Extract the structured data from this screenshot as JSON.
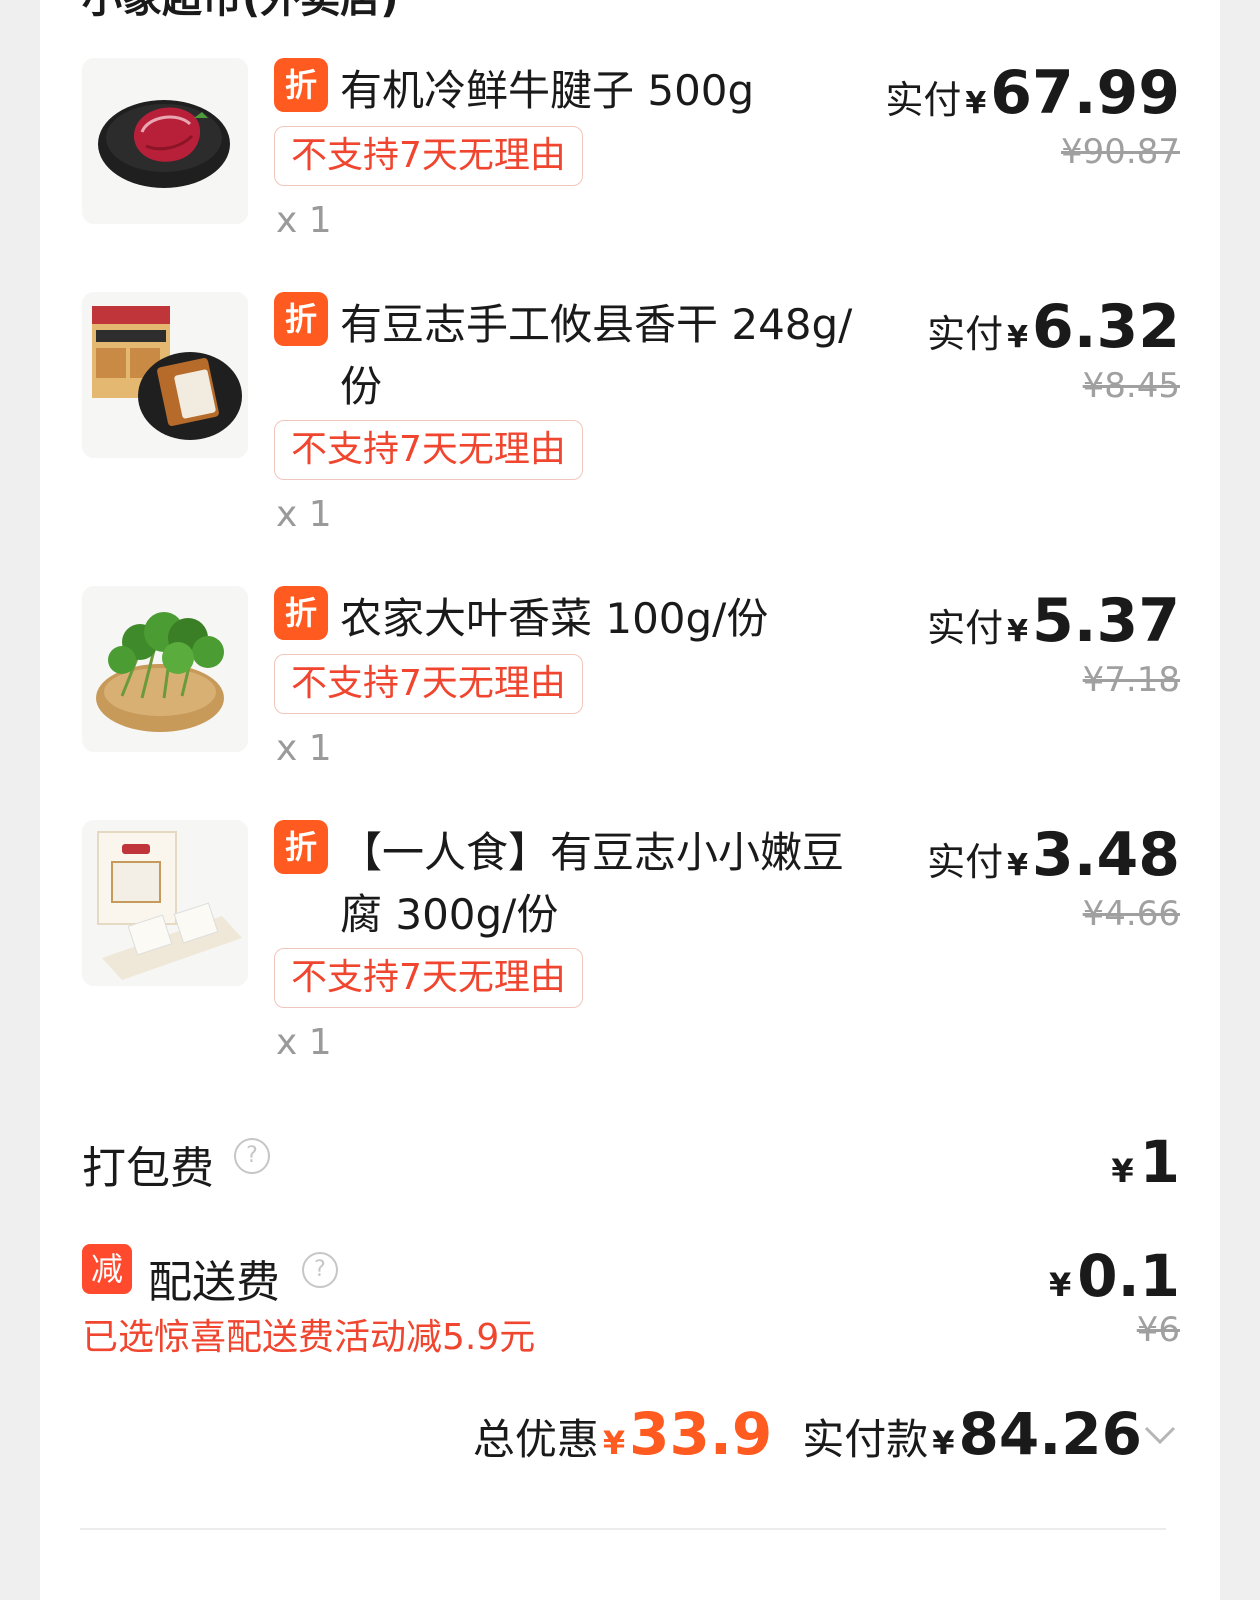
{
  "section": {
    "title": "小象超市(外卖店)"
  },
  "items": [
    {
      "name": "有机冷鲜牛腱子 500g",
      "badge": "折",
      "tag": "不支持7天无理由",
      "qty": "x 1",
      "paid_label": "实付",
      "currency": "¥",
      "price": "67.99",
      "orig_price": "¥90.87",
      "image_icon": "beef-shank-image"
    },
    {
      "name": "有豆志手工攸县香干 248g/份",
      "badge": "折",
      "tag": "不支持7天无理由",
      "qty": "x 1",
      "paid_label": "实付",
      "currency": "¥",
      "price": "6.32",
      "orig_price": "¥8.45",
      "image_icon": "dried-tofu-image"
    },
    {
      "name": "农家大叶香菜 100g/份",
      "badge": "折",
      "tag": "不支持7天无理由",
      "qty": "x 1",
      "paid_label": "实付",
      "currency": "¥",
      "price": "5.37",
      "orig_price": "¥7.18",
      "image_icon": "coriander-image"
    },
    {
      "name": "【一人食】有豆志小小嫩豆腐 300g/份",
      "badge": "折",
      "tag": "不支持7天无理由",
      "qty": "x 1",
      "paid_label": "实付",
      "currency": "¥",
      "price": "3.48",
      "orig_price": "¥4.66",
      "image_icon": "soft-tofu-image"
    }
  ],
  "packing_fee": {
    "label": "打包费",
    "help": "?",
    "currency": "¥",
    "amount": "1"
  },
  "delivery_fee": {
    "badge": "减",
    "label": "配送费",
    "help": "?",
    "currency": "¥",
    "amount": "0.1",
    "orig": "¥6",
    "promo": "已选惊喜配送费活动减5.9元"
  },
  "summary": {
    "discount_label": "总优惠",
    "discount_currency": "¥",
    "discount_amount": "33.9",
    "paid_label": "实付款",
    "paid_currency": "¥",
    "paid_amount": "84.26",
    "expand_icon": "chevron-down-icon"
  },
  "colors": {
    "accent": "#ff5a1f",
    "tag_red": "#f0462f",
    "muted": "#a0a0a0"
  }
}
